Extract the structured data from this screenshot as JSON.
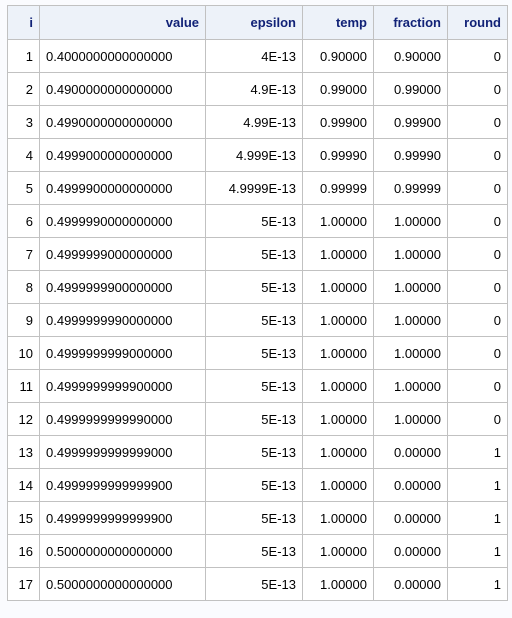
{
  "table": {
    "columns": [
      "i",
      "value",
      "epsilon",
      "temp",
      "fraction",
      "round"
    ],
    "rows": [
      [
        "1",
        "0.4000000000000000",
        "4E-13",
        "0.90000",
        "0.90000",
        "0"
      ],
      [
        "2",
        "0.4900000000000000",
        "4.9E-13",
        "0.99000",
        "0.99000",
        "0"
      ],
      [
        "3",
        "0.4990000000000000",
        "4.99E-13",
        "0.99900",
        "0.99900",
        "0"
      ],
      [
        "4",
        "0.4999000000000000",
        "4.999E-13",
        "0.99990",
        "0.99990",
        "0"
      ],
      [
        "5",
        "0.4999900000000000",
        "4.9999E-13",
        "0.99999",
        "0.99999",
        "0"
      ],
      [
        "6",
        "0.4999990000000000",
        "5E-13",
        "1.00000",
        "1.00000",
        "0"
      ],
      [
        "7",
        "0.4999999000000000",
        "5E-13",
        "1.00000",
        "1.00000",
        "0"
      ],
      [
        "8",
        "0.4999999900000000",
        "5E-13",
        "1.00000",
        "1.00000",
        "0"
      ],
      [
        "9",
        "0.4999999990000000",
        "5E-13",
        "1.00000",
        "1.00000",
        "0"
      ],
      [
        "10",
        "0.4999999999000000",
        "5E-13",
        "1.00000",
        "1.00000",
        "0"
      ],
      [
        "11",
        "0.4999999999900000",
        "5E-13",
        "1.00000",
        "1.00000",
        "0"
      ],
      [
        "12",
        "0.4999999999990000",
        "5E-13",
        "1.00000",
        "1.00000",
        "0"
      ],
      [
        "13",
        "0.4999999999999000",
        "5E-13",
        "1.00000",
        "0.00000",
        "1"
      ],
      [
        "14",
        "0.4999999999999900",
        "5E-13",
        "1.00000",
        "0.00000",
        "1"
      ],
      [
        "15",
        "0.4999999999999900",
        "5E-13",
        "1.00000",
        "0.00000",
        "1"
      ],
      [
        "16",
        "0.5000000000000000",
        "5E-13",
        "1.00000",
        "0.00000",
        "1"
      ],
      [
        "17",
        "0.5000000000000000",
        "5E-13",
        "1.00000",
        "0.00000",
        "1"
      ]
    ]
  },
  "colors": {
    "header_background": "#edf2f9",
    "header_text": "#112277",
    "border": "#c1c1c1",
    "page_background": "#fafbfe"
  }
}
